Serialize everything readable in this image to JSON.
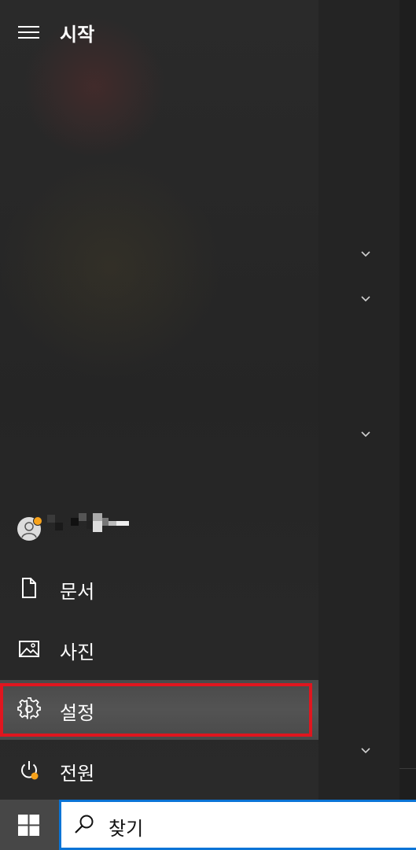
{
  "start_menu": {
    "title": "시작",
    "nav": {
      "documents_label": "문서",
      "pictures_label": "사진",
      "settings_label": "설정",
      "power_label": "전원"
    }
  },
  "taskbar": {
    "search_placeholder": "찾기"
  },
  "icons": {
    "hamburger": "hamburger-icon",
    "user": "user-avatar-icon",
    "documents": "document-icon",
    "pictures": "image-icon",
    "settings": "gear-icon",
    "power": "power-icon",
    "windows": "windows-logo-icon",
    "search": "search-icon",
    "chevron": "chevron-down-icon"
  },
  "colors": {
    "highlight_border": "#e0161f",
    "search_border": "#0a74d6",
    "notification_badge": "#f7a21a"
  }
}
